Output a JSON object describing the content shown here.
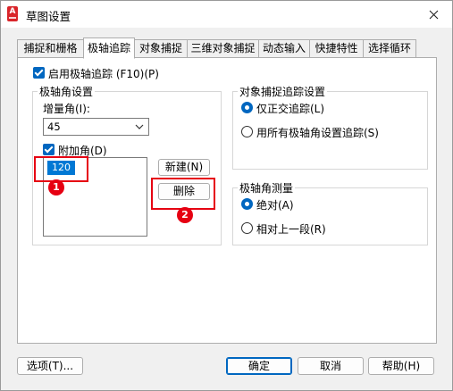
{
  "window": {
    "title": "草图设置",
    "app_icon_letter": "A"
  },
  "tabs": [
    {
      "label": "捕捉和栅格",
      "active": false
    },
    {
      "label": "极轴追踪",
      "active": true
    },
    {
      "label": "对象捕捉",
      "active": false
    },
    {
      "label": "三维对象捕捉",
      "active": false
    },
    {
      "label": "动态输入",
      "active": false
    },
    {
      "label": "快捷特性",
      "active": false
    },
    {
      "label": "选择循环",
      "active": false
    }
  ],
  "polar": {
    "enable_label": "启用极轴追踪 (F10)(P)",
    "enable_checked": true,
    "settings_group": "极轴角设置",
    "increment_label": "增量角(I):",
    "increment_value": "45",
    "additional_label": "附加角(D)",
    "additional_checked": true,
    "additional_angles": [
      "120"
    ],
    "new_button": "新建(N)",
    "delete_button": "删除"
  },
  "snap_tracking": {
    "group_title": "对象捕捉追踪设置",
    "options": [
      {
        "label": "仅正交追踪(L)",
        "selected": true
      },
      {
        "label": "用所有极轴角设置追踪(S)",
        "selected": false
      }
    ]
  },
  "measurement": {
    "group_title": "极轴角测量",
    "options": [
      {
        "label": "绝对(A)",
        "selected": true
      },
      {
        "label": "相对上一段(R)",
        "selected": false
      }
    ]
  },
  "annotations": [
    "1",
    "2"
  ],
  "footer": {
    "options_button": "选项(T)...",
    "ok_button": "确定",
    "cancel_button": "取消",
    "help_button": "帮助(H)"
  },
  "colors": {
    "accent": "#0067c0",
    "annotation_red": "#e60012",
    "app_icon_red": "#d9252a"
  }
}
